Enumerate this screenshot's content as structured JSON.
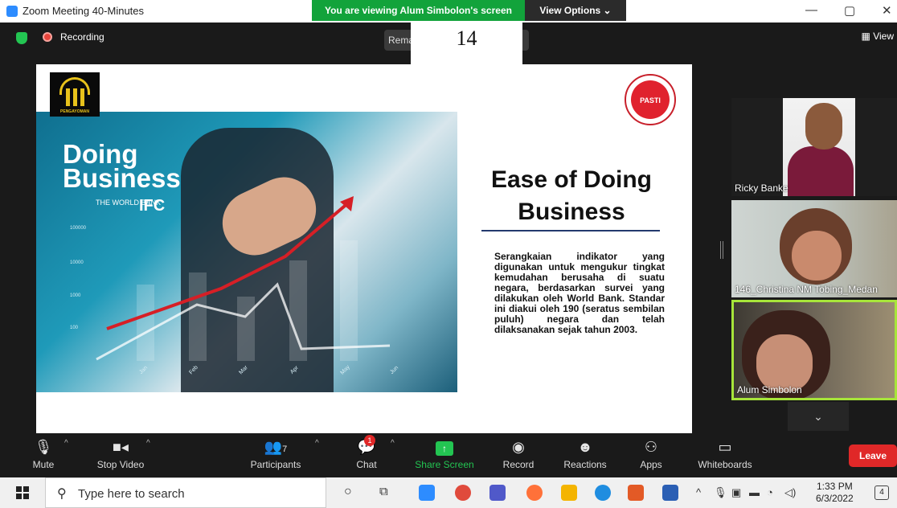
{
  "window": {
    "title": "Zoom Meeting 40-Minutes",
    "banner": "You are viewing Alum Simbolon's screen",
    "view_options": "View Options ⌄",
    "minimize": "—",
    "restore": "▢",
    "close": "✕"
  },
  "topbar": {
    "recording": "Recording",
    "remark": "Rema",
    "page_number": "14",
    "view": "▦ View"
  },
  "slide": {
    "left_logo_caption": "PENGAYOMAN",
    "image_text_line1": "Doing",
    "image_text_line2": "Business",
    "world_bank_label": "THE WORLD BANK",
    "ifc_label": "IFC",
    "y_ticks": [
      "100000",
      "10000",
      "1000",
      "100"
    ],
    "x_ticks": [
      "Jan",
      "Feb",
      "Mar",
      "Apr",
      "May",
      "Jun"
    ],
    "right_logo_label": "PASTI",
    "title_line1": "Ease of Doing",
    "title_line2": "Business",
    "body": "Serangkaian indikator yang digunakan untuk mengukur tingkat kemudahan berusaha di suatu negara, berdasarkan survei yang dilakukan oleh World Bank. Standar ini diakui oleh 190 (seratus sembilan puluh) negara dan telah dilaksanakan sejak tahun 2003."
  },
  "participants": [
    {
      "name": "Ricky Banke"
    },
    {
      "name": "146_Christina NM Tobing_Medan"
    },
    {
      "name": "Alum Simbolon"
    }
  ],
  "panel": {
    "scroll_down": "⌄"
  },
  "toolbar": {
    "mute": "Mute",
    "stop_video": "Stop Video",
    "participants": "Participants",
    "participants_count": "7",
    "chat": "Chat",
    "chat_badge": "1",
    "share_screen": "Share Screen",
    "record": "Record",
    "reactions": "Reactions",
    "apps": "Apps",
    "whiteboards": "Whiteboards",
    "leave": "Leave",
    "share_color": "#23c552",
    "leave_color": "#e02828"
  },
  "taskbar": {
    "search_placeholder": "Type here to search",
    "time": "1:33 PM",
    "date": "6/3/2022",
    "notifications": "4"
  }
}
